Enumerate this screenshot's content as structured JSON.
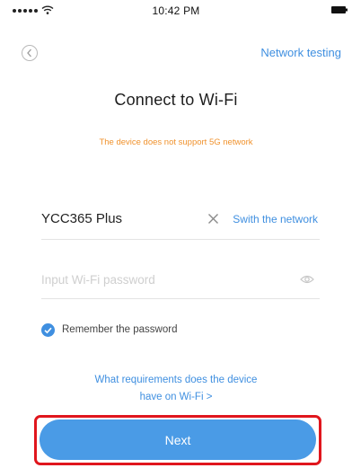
{
  "status_bar": {
    "time": "10:42 PM",
    "icons": [
      "signal-dots",
      "wifi-icon",
      "battery-icon"
    ]
  },
  "nav": {
    "back_icon": "chevron-left-icon",
    "network_testing_label": "Network testing"
  },
  "page": {
    "title": "Connect to Wi-Fi",
    "warning": "The device does not support 5G network"
  },
  "network": {
    "name": "YCC365 Plus",
    "clear_icon": "close-icon",
    "switch_label": "Swith the network"
  },
  "password": {
    "value": "",
    "placeholder": "Input Wi-Fi password",
    "visibility_icon": "eye-icon"
  },
  "remember": {
    "label": "Remember the password",
    "checked": true
  },
  "requirements": {
    "line1": "What requirements does the device",
    "line2": "have on Wi-Fi >"
  },
  "next": {
    "label": "Next"
  },
  "colors": {
    "accent": "#3f8fe0",
    "button": "#4a9be6",
    "warning": "#f0922d",
    "highlight": "#e0161d"
  }
}
